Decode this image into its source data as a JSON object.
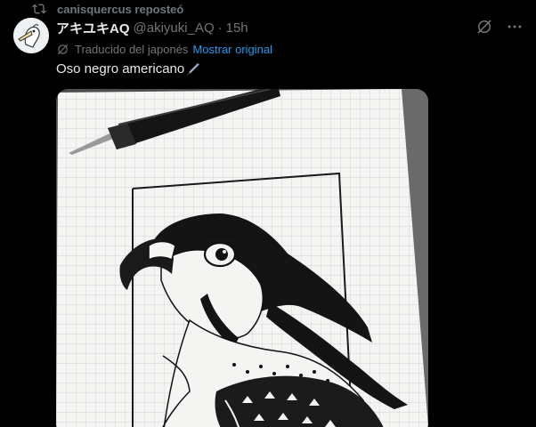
{
  "repost": {
    "label": "canisquercus reposteó",
    "icon": "repost-icon"
  },
  "author": {
    "display_name": "アキユキAQ",
    "handle": "@akiyuki_AQ",
    "separator": "·",
    "time": "15h",
    "avatar": "pelican-avatar"
  },
  "actions": {
    "grok_icon": "grok-icon",
    "more_icon": "more-icon"
  },
  "translation": {
    "label": "Traducido del japonés",
    "show_original": "Mostrar original",
    "icon": "translate-icon"
  },
  "tweet": {
    "text": "Oso negro americano",
    "emoji": "pen-nib-icon"
  },
  "media": {
    "description_icon": "falcon-drawing-image"
  },
  "colors": {
    "background": "#000000",
    "text": "#e7e9ea",
    "muted": "#71767b",
    "link": "#1d9bf0"
  }
}
